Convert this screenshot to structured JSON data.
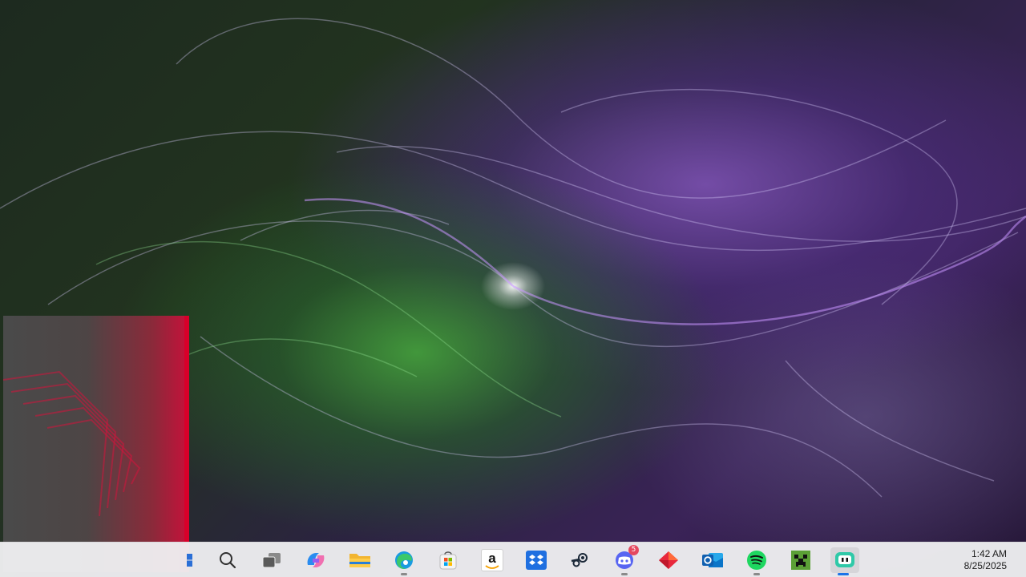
{
  "taskbar": {
    "items": [
      {
        "name": "windows-start",
        "icon": "windows-logo-icon"
      },
      {
        "name": "search",
        "icon": "search-icon"
      },
      {
        "name": "task-view",
        "icon": "task-view-icon"
      },
      {
        "name": "copilot",
        "icon": "copilot-icon"
      },
      {
        "name": "file-explorer",
        "icon": "folder-icon"
      },
      {
        "name": "edge",
        "icon": "edge-icon"
      },
      {
        "name": "microsoft-store",
        "icon": "store-icon"
      },
      {
        "name": "amazon",
        "icon": "amazon-icon",
        "glyph": "a"
      },
      {
        "name": "dropbox",
        "icon": "dropbox-icon"
      },
      {
        "name": "steam",
        "icon": "steam-icon"
      },
      {
        "name": "discord",
        "icon": "discord-icon",
        "badge": "5"
      },
      {
        "name": "git-app",
        "icon": "diamond-app-icon"
      },
      {
        "name": "outlook",
        "icon": "outlook-icon"
      },
      {
        "name": "spotify",
        "icon": "spotify-icon"
      },
      {
        "name": "minecraft",
        "icon": "minecraft-icon"
      },
      {
        "name": "copilot-app",
        "icon": "chat-bot-icon"
      }
    ],
    "clock": {
      "time": "1:42 AM",
      "date": "8/25/2025"
    }
  },
  "colors": {
    "accent": "#1a73e8",
    "panel_red": "#d8002a",
    "taskbar_bg": "#eeeef0"
  }
}
